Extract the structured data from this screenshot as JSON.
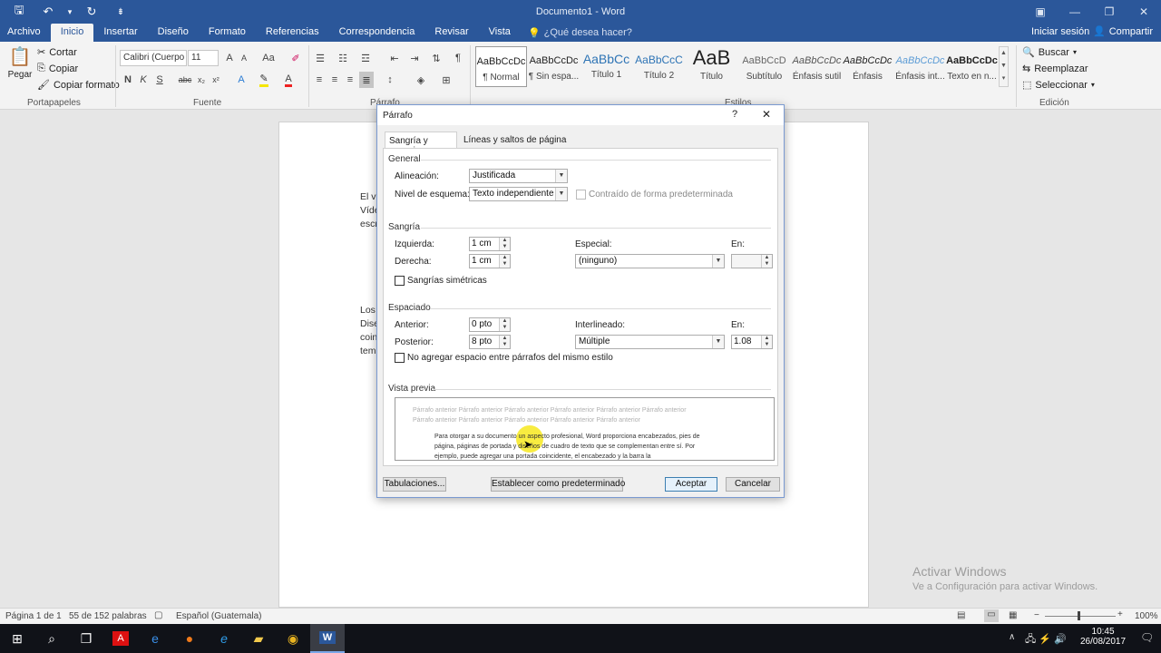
{
  "window": {
    "title": "Documento1 - Word"
  },
  "qat": [
    {
      "icon": "save-icon",
      "glyph": "🖫"
    },
    {
      "icon": "undo-icon",
      "glyph": "↶"
    },
    {
      "icon": "dropdown-icon",
      "glyph": "▾"
    },
    {
      "icon": "redo-icon",
      "glyph": "↻"
    },
    {
      "icon": "customize-icon",
      "glyph": "⇟"
    }
  ],
  "ribbon_tabs": [
    "Archivo",
    "Inicio",
    "Insertar",
    "Diseño",
    "Formato",
    "Referencias",
    "Correspondencia",
    "Revisar",
    "Vista"
  ],
  "active_tab": "Inicio",
  "tell_me": "¿Qué desea hacer?",
  "signin": "Iniciar sesión",
  "share": "Compartir",
  "clipboard": {
    "paste": "Pegar",
    "cut": "Cortar",
    "copy": "Copiar",
    "format_painter": "Copiar formato",
    "group": "Portapapeles"
  },
  "font": {
    "name": "Calibri (Cuerpo",
    "size": "11",
    "group": "Fuente"
  },
  "paragraph": {
    "group": "Párrafo"
  },
  "styles": {
    "group": "Estilos",
    "items": [
      {
        "sample": "AaBbCcDc",
        "name": "¶ Normal"
      },
      {
        "sample": "AaBbCcDc",
        "name": "¶ Sin espa..."
      },
      {
        "sample": "AaBbCc",
        "name": "Título 1"
      },
      {
        "sample": "AaBbCcC",
        "name": "Título 2"
      },
      {
        "sample": "AaB",
        "name": "Título"
      },
      {
        "sample": "AaBbCcD",
        "name": "Subtítulo"
      },
      {
        "sample": "AaBbCcDc",
        "name": "Énfasis sutil"
      },
      {
        "sample": "AaBbCcDc",
        "name": "Énfasis"
      },
      {
        "sample": "AaBbCcDc",
        "name": "Énfasis int..."
      },
      {
        "sample": "AaBbCcDc",
        "name": "Texto en n..."
      }
    ]
  },
  "editing": {
    "find": "Buscar",
    "replace": "Reemplazar",
    "select": "Seleccionar",
    "group": "Edición"
  },
  "page_text": {
    "l1": "El v",
    "l2": "Víde",
    "l3": "escr",
    "l4": "Los",
    "l5": "Dise",
    "l6": "coin",
    "l7": "tem"
  },
  "dialog": {
    "title": "Párrafo",
    "help": "?",
    "close": "✕",
    "tabs": [
      "Sangría y espacio",
      "Líneas y saltos de página"
    ],
    "general": {
      "heading": "General",
      "alignment_label": "Alineación:",
      "alignment_value": "Justificada",
      "outline_label": "Nivel de esquema:",
      "outline_value": "Texto independiente",
      "collapsed_label": "Contraído de forma predeterminada"
    },
    "indent": {
      "heading": "Sangría",
      "left_label": "Izquierda:",
      "left_value": "1 cm",
      "right_label": "Derecha:",
      "right_value": "1 cm",
      "special_label": "Especial:",
      "special_value": "(ninguno)",
      "by_label": "En:",
      "by_value": "",
      "mirror_label": "Sangrías simétricas"
    },
    "spacing": {
      "heading": "Espaciado",
      "before_label": "Anterior:",
      "before_value": "0 pto",
      "after_label": "Posterior:",
      "after_value": "8 pto",
      "line_label": "Interlineado:",
      "line_value": "Múltiple",
      "at_label": "En:",
      "at_value": "1.08",
      "no_space_label": "No agregar espacio entre párrafos del mismo estilo"
    },
    "preview": {
      "heading": "Vista previa",
      "prev1": "Párrafo anterior Párrafo anterior Párrafo anterior Párrafo anterior Párrafo anterior Párrafo anterior",
      "prev2": "Párrafo anterior Párrafo anterior Párrafo anterior Párrafo anterior Párrafo anterior",
      "cur1": "Para otorgar a su documento un aspecto profesional, Word proporciona encabezados, pies de",
      "cur2": "página, páginas de portada y diseños de cuadro de texto que se complementan entre sí. Por",
      "cur3": "ejemplo, puede agregar una portada coincidente, el encabezado y la barra la"
    },
    "buttons": {
      "tabs": "Tabulaciones...",
      "default": "Establecer como predeterminado",
      "ok": "Aceptar",
      "cancel": "Cancelar"
    }
  },
  "status": {
    "page": "Página 1 de 1",
    "words": "55 de 152 palabras",
    "language": "Español (Guatemala)",
    "zoom": "100%"
  },
  "watermark": {
    "l1": "Activar Windows",
    "l2": "Ve a Configuración para activar Windows."
  },
  "taskbar": {
    "time": "10:45",
    "date": "26/08/2017"
  },
  "colors": {
    "accent": "#2b579a",
    "highlight": "#f5e600"
  }
}
